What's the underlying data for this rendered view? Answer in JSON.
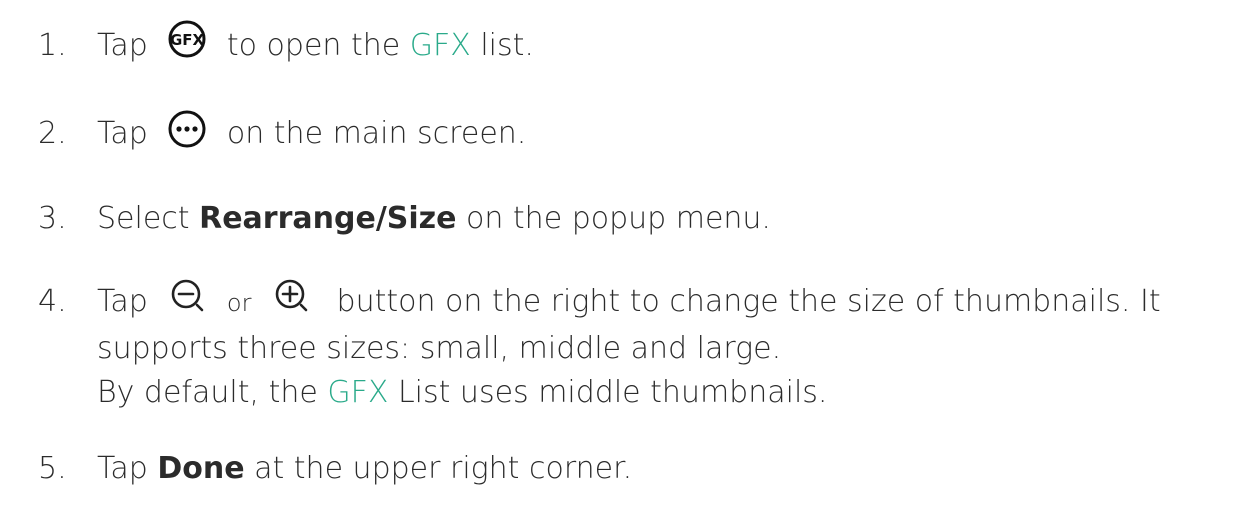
{
  "steps": [
    {
      "number": "1.",
      "pre": "Tap",
      "icon": "gfx-icon",
      "icon_text": "GFX",
      "post_a": "to open the",
      "highlight": "GFX",
      "post_b": "list."
    },
    {
      "number": "2.",
      "pre": "Tap",
      "icon": "more-options-icon",
      "post_a": "on the main screen."
    },
    {
      "number": "3.",
      "pre": "Select",
      "bold": "Rearrange/Size",
      "post_a": "on the popup menu."
    },
    {
      "number": "4.",
      "pre": "Tap",
      "icon_a": "zoom-out-icon",
      "mid": "or",
      "icon_b": "zoom-in-icon",
      "post_a": "button on the right to change the size of thumbnails. It",
      "line2": "supports three sizes: small, middle and large.",
      "line3_pre": "By default, the",
      "line3_highlight": "GFX",
      "line3_post": "List uses middle thumbnails."
    },
    {
      "number": "5.",
      "pre": "Tap",
      "bold": "Done",
      "post_a": "at the upper right corner."
    }
  ],
  "colors": {
    "text": "#2b2b2b",
    "highlight": "#2aaa8a"
  }
}
